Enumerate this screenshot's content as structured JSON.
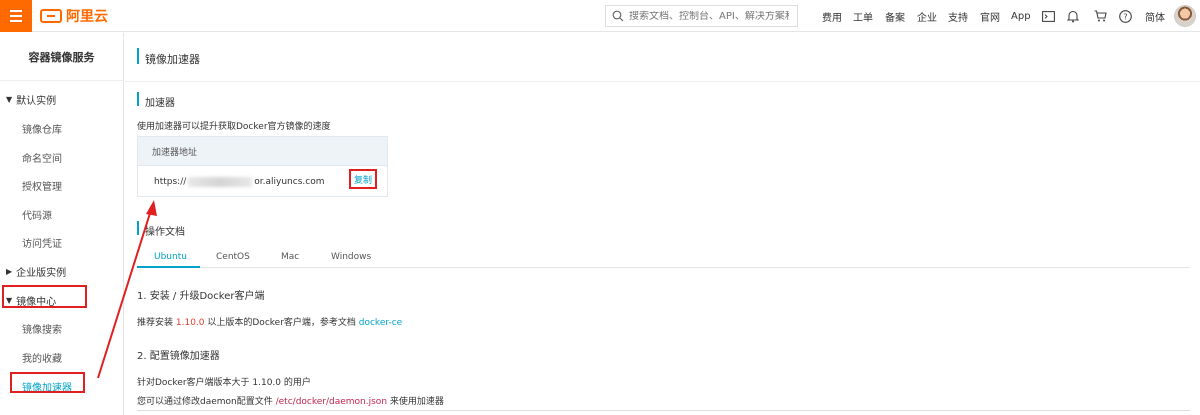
{
  "topbar": {
    "logo_text": "阿里云",
    "search_placeholder": "搜索文档、控制台、API、解决方案和资源",
    "nav": [
      "费用",
      "工单",
      "备案",
      "企业",
      "支持",
      "官网",
      "App"
    ],
    "lang": "简体",
    "icons": [
      "terminal-icon",
      "bell-icon",
      "cart-icon",
      "help-icon"
    ]
  },
  "sidebar": {
    "title": "容器镜像服务",
    "group_default": "默认实例",
    "default_items": [
      "镜像仓库",
      "命名空间",
      "授权管理",
      "代码源",
      "访问凭证"
    ],
    "group_enterprise": "企业版实例",
    "group_mirror": "镜像中心",
    "mirror_items": [
      "镜像搜索",
      "我的收藏",
      "镜像加速器"
    ]
  },
  "main": {
    "page_title": "镜像加速器",
    "section_accelerator": "加速器",
    "desc": "使用加速器可以提升获取Docker官方镜像的速度",
    "acc_head": "加速器地址",
    "acc_prefix": "https://",
    "acc_suffix": "or.aliyuncs.com",
    "copy_label": "复制",
    "section_docs": "操作文档",
    "tabs": [
      "Ubuntu",
      "CentOS",
      "Mac",
      "Windows"
    ],
    "step1_title": "1. 安装 / 升级Docker客户端",
    "step1_pre": "推荐安装 ",
    "step1_ver": "1.10.0",
    "step1_mid": " 以上版本的Docker客户端，参考文档 ",
    "step1_link": "docker-ce",
    "step2_title": "2. 配置镜像加速器",
    "step2_line1": "针对Docker客户端版本大于 1.10.0 的用户",
    "step2_pre": "您可以通过修改daemon配置文件 ",
    "step2_path": "/etc/docker/daemon.json",
    "step2_post": " 来使用加速器"
  },
  "colors": {
    "brand": "#ff6a00",
    "accent": "#00a2ca",
    "highlight": "#e02020"
  }
}
